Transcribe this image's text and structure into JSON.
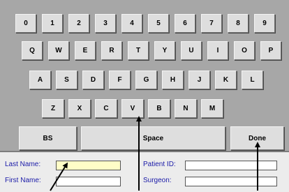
{
  "keyboard": {
    "rows": [
      [
        "0",
        "1",
        "2",
        "3",
        "4",
        "5",
        "6",
        "7",
        "8",
        "9"
      ],
      [
        "Q",
        "W",
        "E",
        "R",
        "T",
        "Y",
        "U",
        "I",
        "O",
        "P"
      ],
      [
        "A",
        "S",
        "D",
        "F",
        "G",
        "H",
        "J",
        "K",
        "L"
      ],
      [
        "Z",
        "X",
        "C",
        "V",
        "B",
        "N",
        "M"
      ]
    ],
    "backspace_label": "BS",
    "space_label": "Space",
    "done_label": "Done"
  },
  "form": {
    "last_name_label": "Last Name:",
    "last_name_value": "",
    "first_name_label": "First Name:",
    "first_name_value": "",
    "patient_id_label": "Patient ID:",
    "patient_id_value": "",
    "surgeon_label": "Surgeon:",
    "surgeon_value": ""
  }
}
